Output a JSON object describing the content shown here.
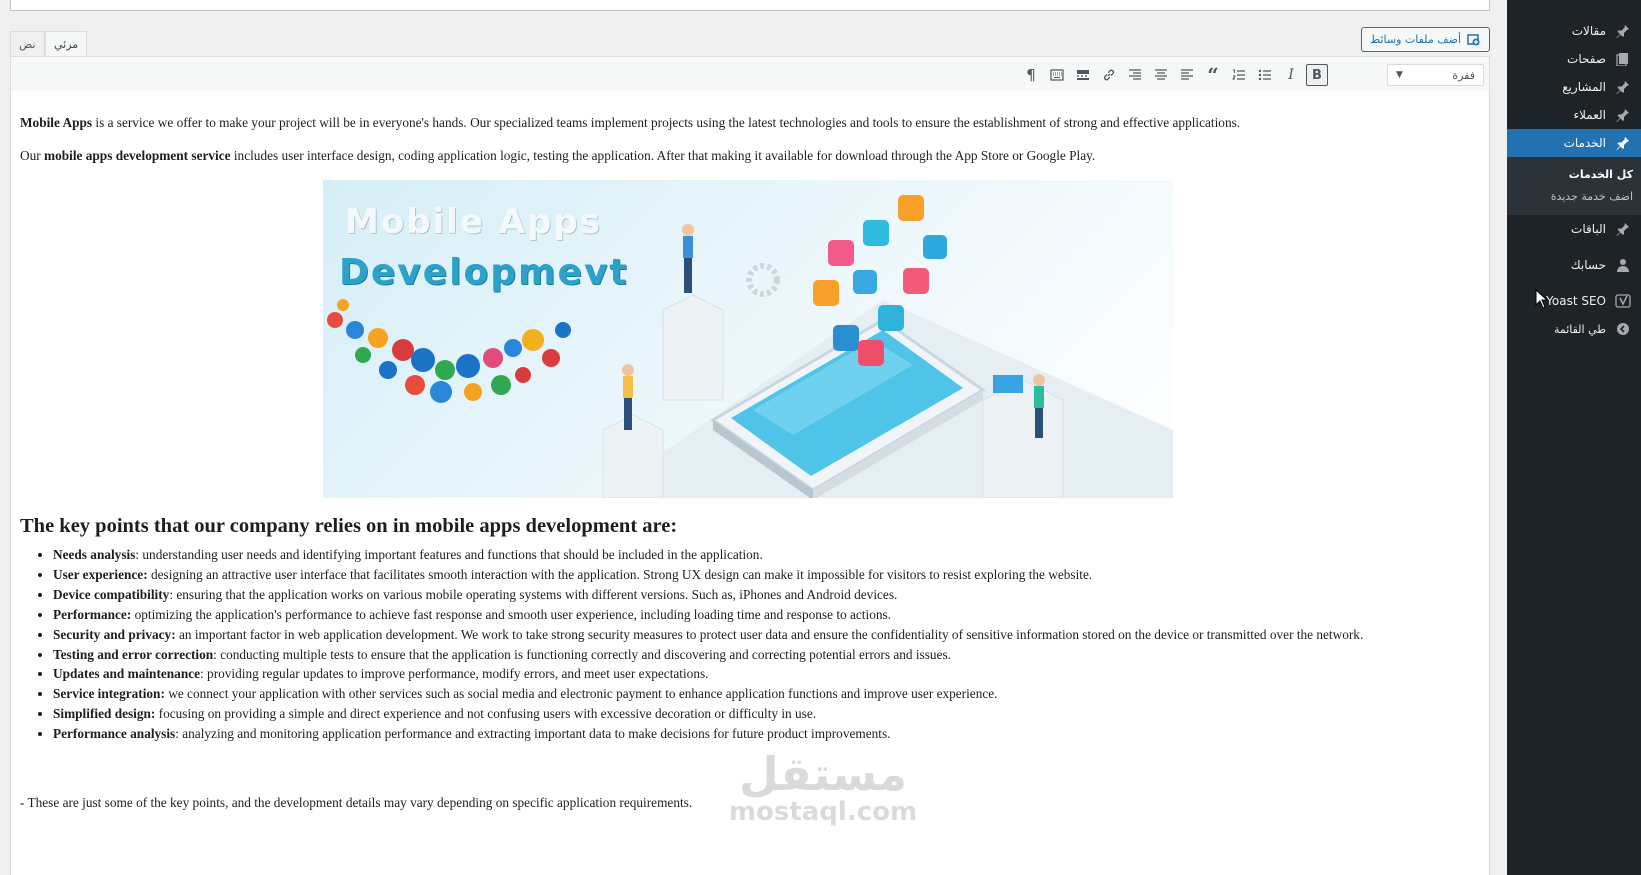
{
  "sidebar": {
    "items": [
      {
        "label": "مقالات",
        "icon": "pin-icon"
      },
      {
        "label": "صفحات",
        "icon": "pages-icon"
      },
      {
        "label": "المشاريع",
        "icon": "pin-icon"
      },
      {
        "label": "العملاء",
        "icon": "pin-icon"
      },
      {
        "label": "الخدمات",
        "icon": "pin-icon",
        "active": true
      },
      {
        "label": "الباقات",
        "icon": "pin-icon"
      },
      {
        "label": "حسابك",
        "icon": "user-icon"
      },
      {
        "label": "Yoast SEO",
        "icon": "yoast-icon"
      },
      {
        "label": "طي القائمة",
        "icon": "collapse-icon"
      }
    ],
    "submenu": [
      {
        "label": "كل الخدمات",
        "current": true
      },
      {
        "label": "اضف خدمة جديدة"
      }
    ]
  },
  "editor": {
    "add_media_label": "أضف ملفات وسائط",
    "tab_visual": "مرئي",
    "tab_text": "نص",
    "format_select": "فقرة",
    "toolbar_icons": [
      "bold-icon",
      "italic-icon",
      "bullet-list-icon",
      "numbered-list-icon",
      "blockquote-icon",
      "align-left-icon",
      "align-center-icon",
      "align-right-icon",
      "link-icon",
      "read-more-icon",
      "toolbar-toggle-icon",
      "paragraph-mark-icon"
    ]
  },
  "content": {
    "para1_bold": "Mobile Apps",
    "para1_rest": " is a service we offer to make your project will be in everyone's hands. Our specialized teams implement projects using the latest technologies and tools to ensure the establishment of strong and effective applications.",
    "para2_start": "Our ",
    "para2_bold": "mobile apps development service",
    "para2_rest": " includes user interface design, coding application logic, testing the application. After that making it available for download through the App Store or Google Play.",
    "image_title_line1": "Mobile Apps",
    "image_title_line2": "Developmevt",
    "heading": "The key points that our company relies on in mobile apps development are:",
    "list": [
      {
        "term": "Needs analysis",
        "text": ": understanding user needs and identifying important features and functions that should be included in the application."
      },
      {
        "term": "User experience:",
        "text": " designing an attractive user interface that facilitates smooth interaction with the application. Strong UX design can make it impossible for visitors to resist exploring the website."
      },
      {
        "term": "Device compatibility",
        "text": ": ensuring that the application works on various mobile operating systems with different versions. Such as, iPhones and Android devices."
      },
      {
        "term": "Performance:",
        "text": " optimizing the application's performance to achieve fast response and smooth user experience, including loading time and response to actions."
      },
      {
        "term": "Security and privacy:",
        "text": " an important factor in web application development. We work to take strong security measures to protect user data and ensure the confidentiality of sensitive information stored on the device or transmitted over the network."
      },
      {
        "term": "Testing and error correction",
        "text": ": conducting multiple tests to ensure that the application is functioning correctly and discovering and correcting potential errors and issues."
      },
      {
        "term": "Updates and maintenance",
        "text": ": providing regular updates to improve performance, modify errors, and meet user expectations."
      },
      {
        "term": "Service integration:",
        "text": " we connect your application with other services such as social media and electronic payment to enhance application functions and improve user experience."
      },
      {
        "term": "Simplified design:",
        "text": " focusing on providing a simple and direct experience and not confusing users with excessive decoration or difficulty in use."
      },
      {
        "term": "Performance analysis",
        "text": ": analyzing and monitoring application performance and extracting important data to make decisions for future product improvements."
      }
    ],
    "footer_note": "- These are just some of the key points, and the development details may vary depending on specific application requirements."
  },
  "watermark": {
    "arabic": "مستقل",
    "latin": "mostaql.com"
  },
  "colors": {
    "sidebar_bg": "#1d2327",
    "active_blue": "#2271b1",
    "page_bg": "#f0f0f1"
  }
}
